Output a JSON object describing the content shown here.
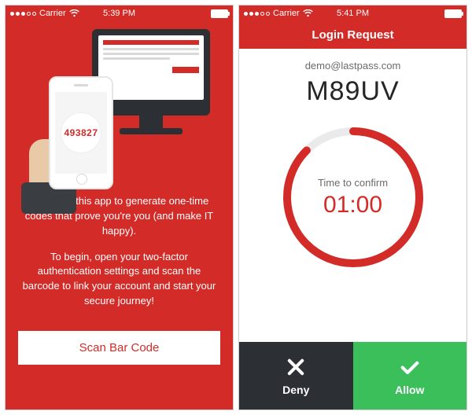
{
  "screen1": {
    "status": {
      "carrier": "Carrier",
      "time": "5:39 PM"
    },
    "illustration_code": "493827",
    "para1": "You'll use this app to generate one-time codes that prove you're you (and make IT happy).",
    "para2": "To begin, open your two-factor authentication settings and scan the barcode to link your account and start your secure journey!",
    "scan_button": "Scan Bar Code"
  },
  "screen2": {
    "status": {
      "carrier": "Carrier",
      "time": "5:41 PM"
    },
    "header_title": "Login Request",
    "email": "demo@lastpass.com",
    "code": "M89UV",
    "timer_label": "Time to confirm",
    "timer_value": "01:00",
    "deny_label": "Deny",
    "allow_label": "Allow"
  }
}
